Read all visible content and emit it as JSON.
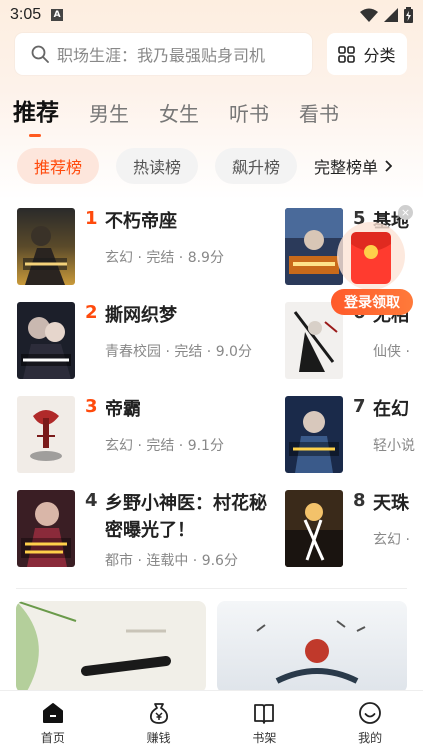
{
  "status_bar": {
    "time": "3:05",
    "notification_badge": "A"
  },
  "search": {
    "placeholder": "职场生涯：我乃最强贴身司机"
  },
  "category_button": {
    "label": "分类"
  },
  "tabs": [
    {
      "label": "推荐",
      "active": true
    },
    {
      "label": "男生"
    },
    {
      "label": "女生"
    },
    {
      "label": "听书"
    },
    {
      "label": "看书"
    }
  ],
  "chips": [
    {
      "label": "推荐榜",
      "active": true
    },
    {
      "label": "热读榜"
    },
    {
      "label": "飙升榜"
    }
  ],
  "full_list": {
    "label": "完整榜单"
  },
  "books_left": [
    {
      "rank": "1",
      "title": "不朽帝座",
      "meta": "玄幻 · 完结 · 8.9分"
    },
    {
      "rank": "2",
      "title": "撕网织梦",
      "meta": "青春校园 · 完结 · 9.0分"
    },
    {
      "rank": "3",
      "title": "帝霸",
      "meta": "玄幻 · 完结 · 9.1分"
    },
    {
      "rank": "4",
      "title": "乡野小神医：村花秘密曝光了！",
      "title_line1": "乡野小神医：村花秘",
      "title_line2": "密曝光了！",
      "meta": "都市 · 连载中 · 9.6分"
    }
  ],
  "books_right": [
    {
      "rank": "5",
      "title": "基地",
      "meta": ""
    },
    {
      "rank": "6",
      "title": "无相",
      "meta": "仙侠 ·"
    },
    {
      "rank": "7",
      "title": "在幻",
      "meta": "轻小说"
    },
    {
      "rank": "8",
      "title": "天珠",
      "meta": "玄幻 ·"
    }
  ],
  "float_promo": {
    "button": "登录领取",
    "close": "×"
  },
  "bottom_nav": [
    {
      "label": "首页",
      "icon": "home-icon",
      "active": true
    },
    {
      "label": "赚钱",
      "icon": "money-bag-icon"
    },
    {
      "label": "书架",
      "icon": "bookshelf-icon"
    },
    {
      "label": "我的",
      "icon": "smile-profile-icon"
    }
  ],
  "colors": {
    "accent": "#ff4a0c",
    "chip_active_bg": "#fde6dc",
    "top_gradient": "#fdeee0"
  }
}
